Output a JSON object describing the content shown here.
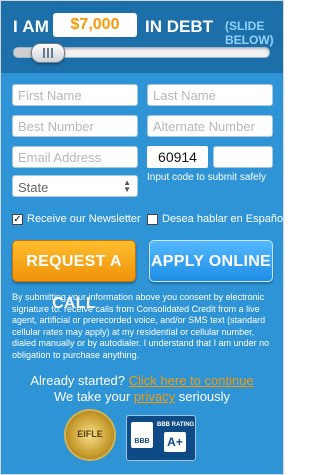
{
  "header": {
    "prefix": "I AM",
    "amount": "$7,000",
    "suffix": "IN DEBT",
    "hint": "(SLIDE BELOW)"
  },
  "slider": {
    "level_fraction": 0.13
  },
  "form": {
    "first_name_placeholder": "First Name",
    "last_name_placeholder": "Last Name",
    "best_number_placeholder": "Best Number",
    "alternate_number_placeholder": "Alternate Number",
    "email_placeholder": "Email Address",
    "captcha_code": "60914",
    "captcha_input_value": "",
    "captcha_hint": "Input code to submit safely",
    "state_selected": "State"
  },
  "checkboxes": {
    "newsletter_label": "Receive our Newsletter",
    "newsletter_checked": true,
    "spanish_label": "Desea hablar en Español",
    "spanish_checked": false
  },
  "buttons": {
    "request_call": "REQUEST A CALL",
    "apply_online": "APPLY ONLINE"
  },
  "disclaimer": "By submitting your information above you consent by electronic signature to: receive calls from Consolidated Credit from a live agent, artificial or prerecorded voice, and/or SMS text (standard cellular rates may apply) at my residential or cellular number, dialed manually or by autodialer. I understand that I am under no obligation to purchase anything.",
  "footer": {
    "already_text": "Already started?",
    "continue_link": "Click here to continue",
    "privacy_pre": "We take your",
    "privacy_link": "privacy",
    "privacy_post": "seriously"
  },
  "badges": {
    "eifle_label": "EIFLE",
    "bbb_logo": "BBB",
    "bbb_rating_label": "BBB RATING",
    "bbb_grade": "A+"
  },
  "colors": {
    "panel_blue": "#2e94d6",
    "header_blue": "#1c6fa8",
    "accent_orange": "#f29a0a"
  }
}
